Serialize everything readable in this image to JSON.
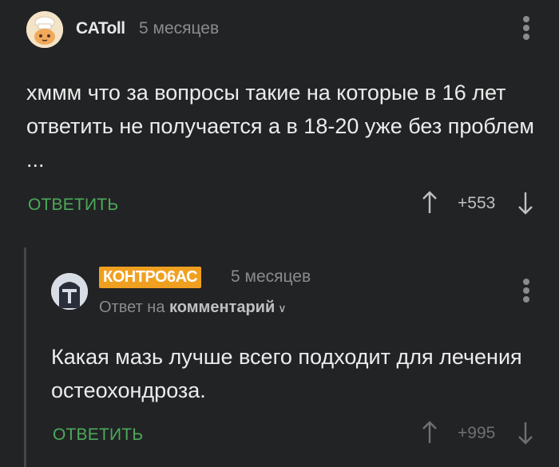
{
  "comments": [
    {
      "username": "CAToll",
      "time": "5 месяцев",
      "text": "хммм что за вопросы такие на которые в 16 лет ответить не получается а в 18-20 уже без проблем ...",
      "reply_label": "ОТВЕТИТЬ",
      "score": "+553",
      "avatar_icon": "cat-chef-avatar"
    },
    {
      "username": "КОНТРО6АС",
      "time": "5 месяцев",
      "reply_to_prefix": "Ответ на",
      "reply_to_link": "комментарий",
      "text": "Какая мазь лучше всего подходит для лечения остеохондроза.",
      "reply_label": "ОТВЕТИТЬ",
      "score": "+995",
      "avatar_icon": "knight-helmet-avatar",
      "username_badge_color": "#f0a020"
    }
  ],
  "colors": {
    "background": "#222325",
    "accent_green": "#4caa5a",
    "muted": "#8a8b8d"
  }
}
